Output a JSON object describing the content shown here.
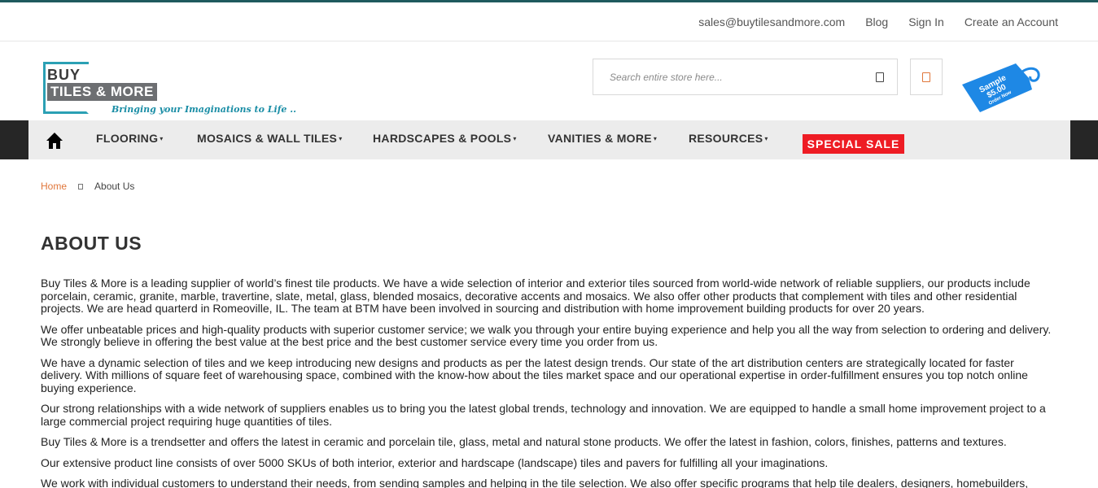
{
  "top_links": {
    "email": "sales@buytilesandmore.com",
    "blog": "Blog",
    "sign_in": "Sign In",
    "create_account": "Create an Account"
  },
  "logo": {
    "line1": "BUY",
    "line2": "TILES & MORE",
    "tagline": "Bringing your Imaginations to Life .."
  },
  "search": {
    "placeholder": "Search entire store here..."
  },
  "sample_tag": {
    "line1": "Sample",
    "line2": "$5.00",
    "line3": "Order Now",
    "color": "#1e88e5"
  },
  "nav": {
    "items": [
      {
        "label": "FLOORING"
      },
      {
        "label": "MOSAICS & WALL TILES"
      },
      {
        "label": "HARDSCAPES & POOLS"
      },
      {
        "label": "VANITIES & MORE"
      },
      {
        "label": "RESOURCES"
      }
    ],
    "caret": "▾",
    "special_sale": "SPECIAL SALE"
  },
  "breadcrumb": {
    "home": "Home",
    "current": "About Us"
  },
  "page": {
    "title": "ABOUT US",
    "paragraphs": [
      "Buy Tiles & More is a leading supplier of world’s finest tile products. We have a wide selection of interior and exterior tiles sourced from world-wide network of reliable suppliers, our products include porcelain, ceramic, granite, marble, travertine, slate, metal, glass, blended mosaics, decorative accents and mosaics. We also offer other products that complement with tiles and other residential projects. We are head quarterd in Romeoville, IL. The team at BTM have been involved in sourcing and distribution with home improvement building products for over 20 years.",
      "We offer unbeatable prices and high-quality products with superior customer service; we walk you through your entire buying experience and help you all the way from selection to ordering and delivery. We strongly believe in offering the best value at the best price and the best customer service every time you order from us.",
      "We have a dynamic selection of tiles and we keep introducing new designs and products as per the latest design trends. Our state of the art distribution centers are strategically located for faster delivery. With millions of square feet of warehousing space, combined with the know-how about the tiles market space and our operational expertise in order-fulfillment ensures you top notch online buying experience.",
      "Our strong relationships with a wide network of suppliers enables us to bring you the latest global trends, technology and innovation. We are equipped to handle a small home improvement project to a large commercial project requiring huge quantities of tiles.",
      "Buy Tiles & More is a trendsetter and offers the latest in ceramic and porcelain tile, glass, metal and natural stone products. We offer the latest in fashion, colors, finishes, patterns and textures.",
      "Our extensive product line consists of over 5000 SKUs of both interior, exterior and hardscape (landscape) tiles and pavers for fulfilling all your imaginations.",
      "We work with individual customers to understand their needs, from sending samples and helping in the tile selection. We also offer specific programs that help tile dealers, designers, homebuilders,"
    ]
  }
}
